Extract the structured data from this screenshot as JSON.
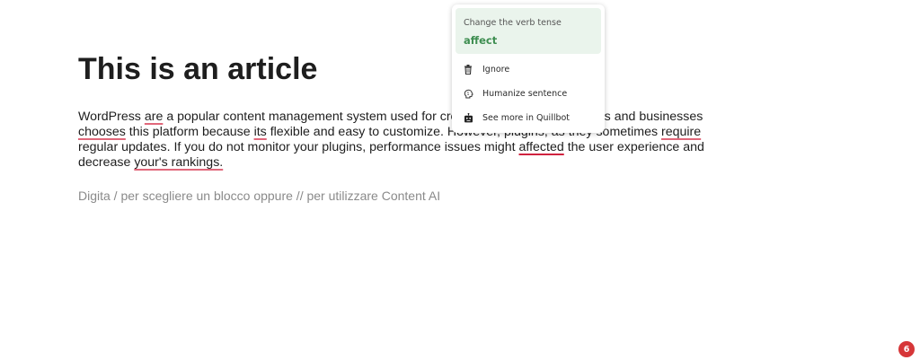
{
  "article": {
    "title": "This is an article",
    "body": {
      "p1": "WordPress ",
      "e1": "are",
      "p2": " a popular content management system used for creating websites. Many blogs and businesses ",
      "e2": "chooses",
      "p3": " this platform because ",
      "e3": "its",
      "p4": " flexible and easy to customize. However, plugins, as they sometimes ",
      "e4": "require",
      "p5": " regular updates. If you do not monitor your plugins, performance issues might ",
      "e5": "affected",
      "p6": " the user experience and decrease ",
      "e6": "your's rankings.",
      "p7": ""
    },
    "placeholder": "Digita / per scegliere un blocco oppure // per utilizzare Content AI"
  },
  "popup": {
    "suggestion_label": "Change the verb tense",
    "suggestion_word": "affect",
    "menu": [
      {
        "label": "Ignore",
        "icon": "trash-icon"
      },
      {
        "label": "Humanize sentence",
        "icon": "brain-icon"
      },
      {
        "label": "See more in Quillbot",
        "icon": "robot-icon"
      }
    ]
  },
  "notification_badge": {
    "count": "6",
    "color": "#d63638"
  },
  "colors": {
    "suggestion_bg": "#eaf4ec",
    "suggestion_text": "#3e8e51",
    "error_underline": "#e0677a"
  }
}
